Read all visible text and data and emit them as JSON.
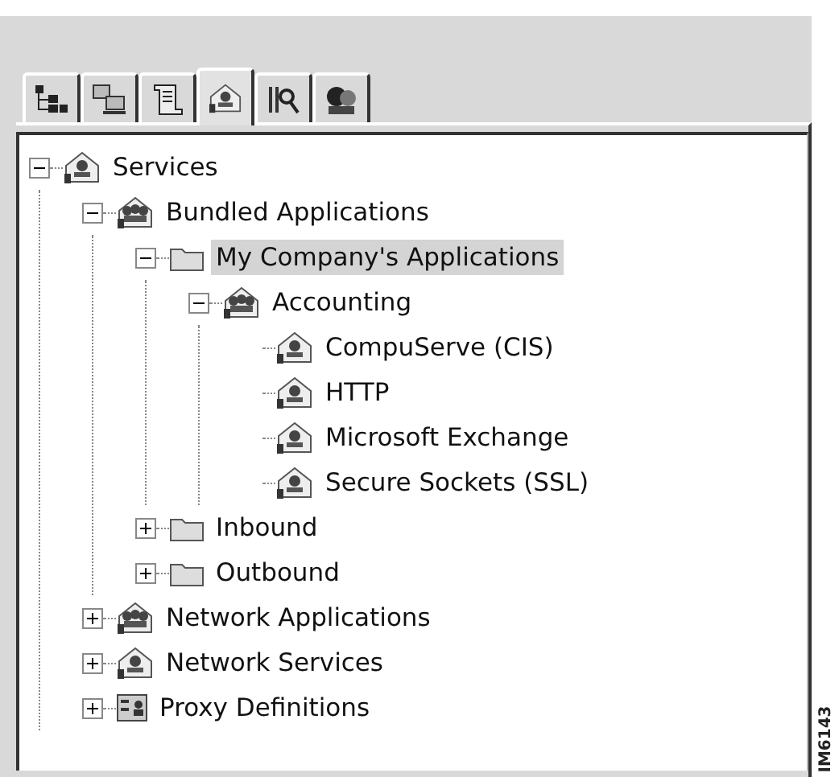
{
  "tabs": [
    {
      "kind": "tree",
      "selected": false
    },
    {
      "kind": "hosts",
      "selected": false
    },
    {
      "kind": "document",
      "selected": false
    },
    {
      "kind": "service",
      "selected": true
    },
    {
      "kind": "keys",
      "selected": false
    },
    {
      "kind": "users",
      "selected": false
    }
  ],
  "tree": [
    {
      "label": "Services",
      "kind": "service",
      "expanded": true,
      "selected": false,
      "children": [
        {
          "label": "Bundled Applications",
          "kind": "group",
          "expanded": true,
          "selected": false,
          "children": [
            {
              "label": "My Company's Applications",
              "kind": "folder",
              "expanded": true,
              "selected": true,
              "children": [
                {
                  "label": "Accounting",
                  "kind": "group",
                  "expanded": true,
                  "selected": false,
                  "children": [
                    {
                      "label": "CompuServe (CIS)",
                      "kind": "service",
                      "selected": false
                    },
                    {
                      "label": "HTTP",
                      "kind": "service",
                      "selected": false
                    },
                    {
                      "label": "Microsoft Exchange",
                      "kind": "service",
                      "selected": false
                    },
                    {
                      "label": "Secure Sockets (SSL)",
                      "kind": "service",
                      "selected": false
                    }
                  ]
                }
              ]
            },
            {
              "label": "Inbound",
              "kind": "folder",
              "expanded": false,
              "selected": false
            },
            {
              "label": "Outbound",
              "kind": "folder",
              "expanded": false,
              "selected": false
            }
          ]
        },
        {
          "label": "Network Applications",
          "kind": "group",
          "expanded": false,
          "selected": false
        },
        {
          "label": "Network Services",
          "kind": "service",
          "expanded": false,
          "selected": false
        },
        {
          "label": "Proxy Definitions",
          "kind": "proxy",
          "expanded": false,
          "selected": false
        }
      ]
    }
  ],
  "figure_id": "IM6143"
}
